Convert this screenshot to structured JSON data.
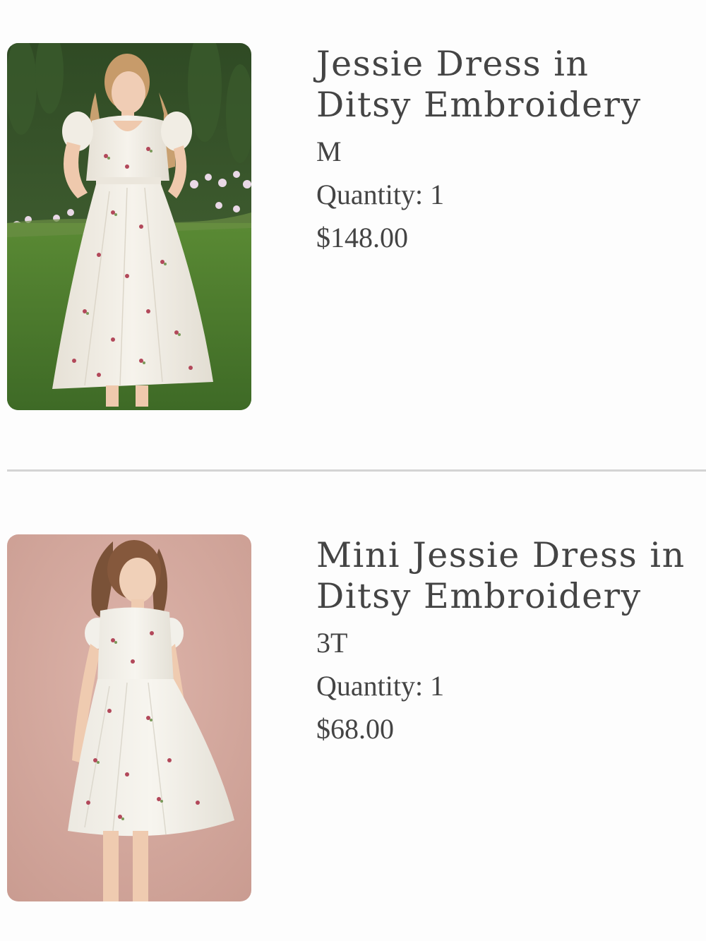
{
  "cart": {
    "items": [
      {
        "name": "Jessie Dress in\nDitsy Embroidery",
        "size": "M",
        "quantity": "Quantity: 1",
        "price": "$148.00",
        "image_icon": "product-photo-woman-in-floral-dress"
      },
      {
        "name": "Mini Jessie Dress in\nDitsy Embroidery",
        "size": "3T",
        "quantity": "Quantity: 1",
        "price": "$68.00",
        "image_icon": "product-photo-girl-in-floral-dress"
      }
    ]
  },
  "colors": {
    "text": "#444444",
    "divider": "#d4d4d4",
    "background": "#fdfdfd",
    "hedge": "#3f5a2e",
    "lawn": "#4f7a30",
    "pink_backdrop": "#d7aaa0",
    "dress": "#f3efe6",
    "embroidery": "#b2485a"
  }
}
